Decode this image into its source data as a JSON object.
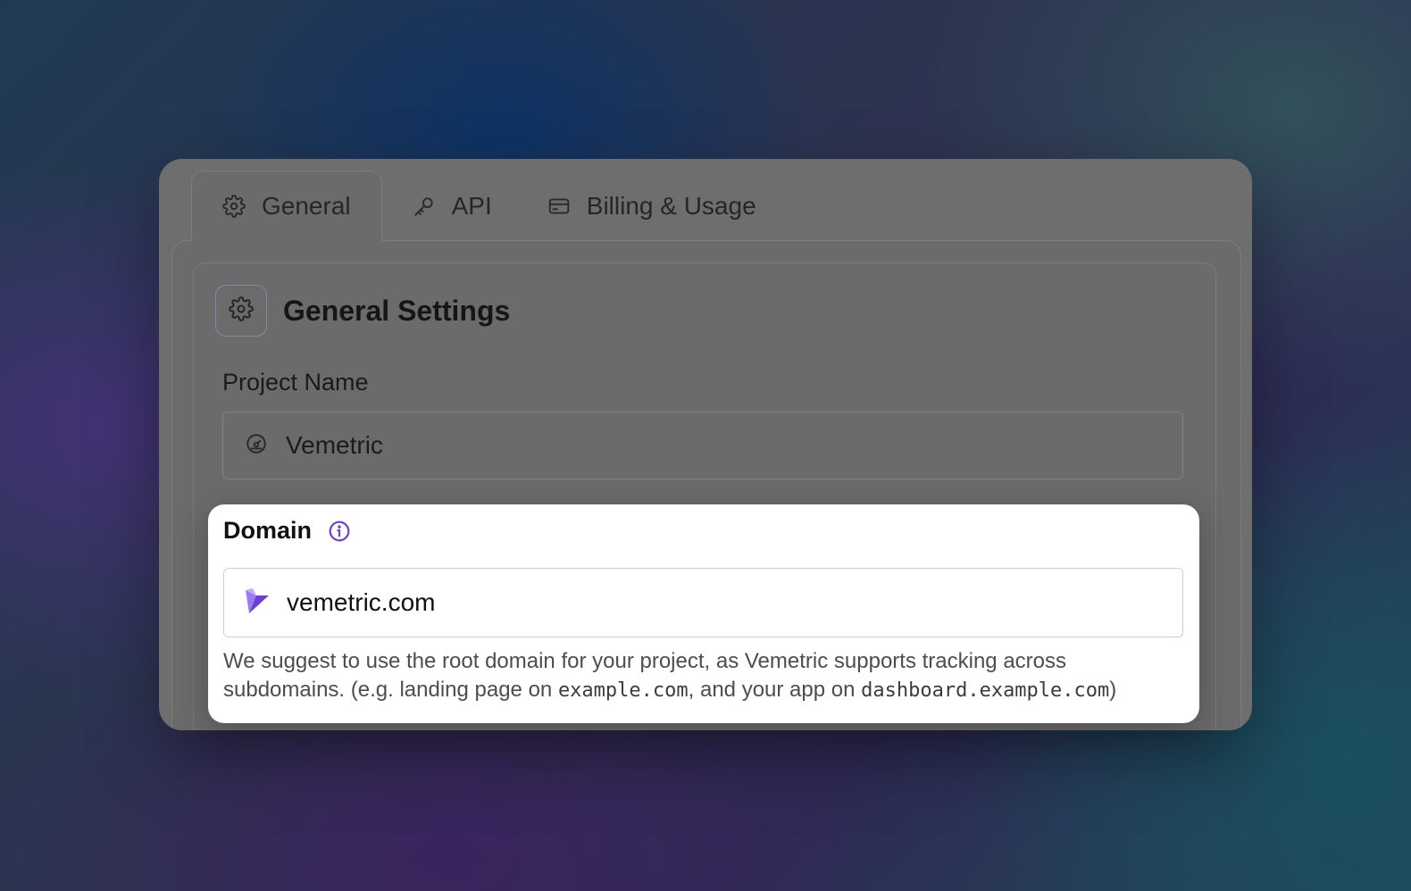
{
  "tabs": [
    {
      "label": "General",
      "icon": "gear-icon",
      "active": true
    },
    {
      "label": "API",
      "icon": "key-icon",
      "active": false
    },
    {
      "label": "Billing & Usage",
      "icon": "credit-card-icon",
      "active": false
    }
  ],
  "card": {
    "title": "General Settings",
    "icon": "gear-icon"
  },
  "project_name": {
    "label": "Project Name",
    "value": "Vemetric",
    "icon": "gauge-icon"
  },
  "domain": {
    "label": "Domain",
    "info_icon": "info-icon",
    "value": "vemetric.com",
    "icon": "vemetric-logo-icon",
    "help_prefix": "We suggest to use the root domain for your project, as Vemetric supports tracking across subdomains. (e.g. landing page on ",
    "help_example_1": "example.com",
    "help_middle": ", and your app on ",
    "help_example_2": "dashboard.example.com",
    "help_suffix": ")"
  },
  "colors": {
    "accent": "#6b3fd6",
    "overlay": "#6e6e6e",
    "highlight_bg": "#ffffff"
  }
}
